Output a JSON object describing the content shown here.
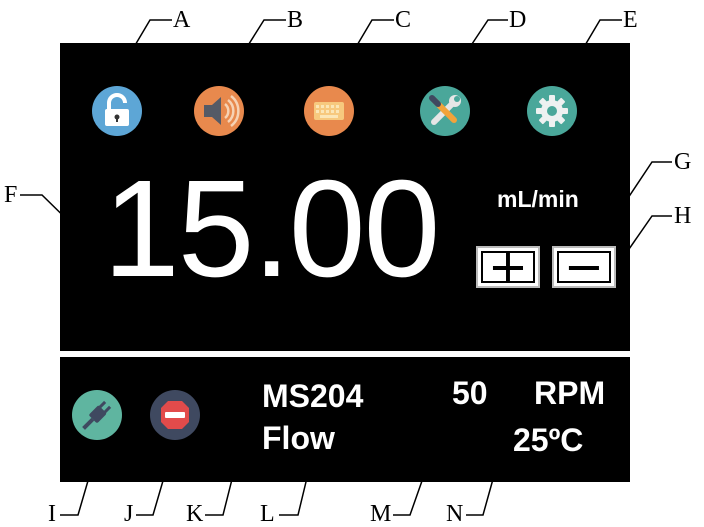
{
  "callouts": [
    "A",
    "B",
    "C",
    "D",
    "E",
    "F",
    "G",
    "H",
    "I",
    "J",
    "K",
    "L",
    "M",
    "N"
  ],
  "display": {
    "value": "15.00",
    "unit": "mL/min",
    "plus_label": "+",
    "minus_label": "−"
  },
  "status": {
    "pump_model": "MS204",
    "mode": "Flow",
    "speed": "50",
    "speed_unit": "RPM",
    "temperature": "25ºC"
  },
  "icons": {
    "lock": "unlock-icon",
    "sound": "speaker-icon",
    "keyboard": "keyboard-icon",
    "tools": "tools-icon",
    "settings": "gear-icon",
    "power": "plug-icon",
    "stop": "stop-icon"
  },
  "colors": {
    "lock_bg": "#5da6d6",
    "sound_bg": "#e8894d",
    "keyboard_bg": "#e8894d",
    "tools_bg": "#4aa79a",
    "settings_bg": "#4aa79a",
    "power_bg": "#5fb5a0",
    "stop_bg": "#3f4960",
    "stop_red": "#e24b4b"
  }
}
